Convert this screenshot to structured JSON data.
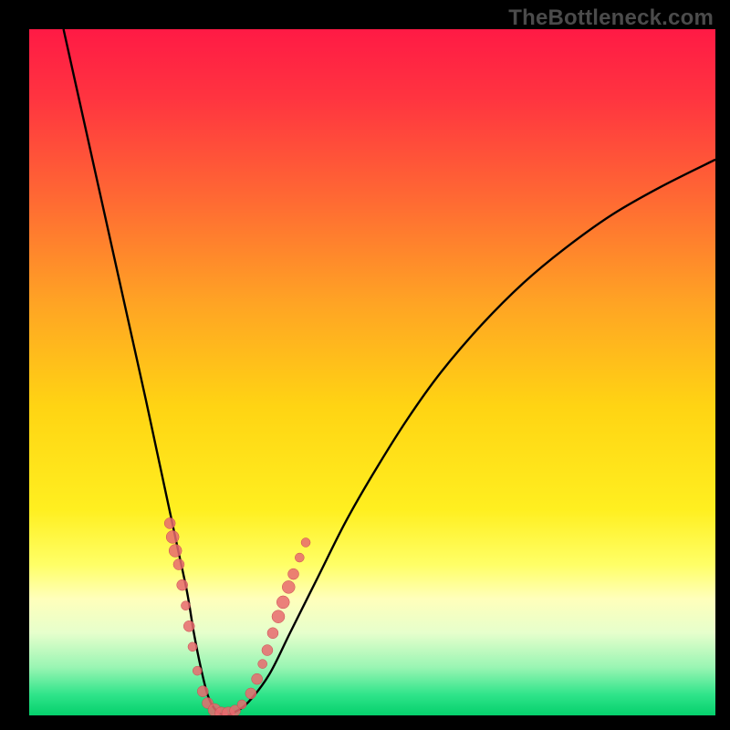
{
  "watermark": "TheBottleneck.com",
  "colors": {
    "frame": "#000000",
    "curve": "#000000",
    "markers_fill": "#e86a6f",
    "markers_stroke": "#c94b50",
    "gradient_stops": [
      {
        "offset": 0.0,
        "color": "#ff1a45"
      },
      {
        "offset": 0.1,
        "color": "#ff3440"
      },
      {
        "offset": 0.25,
        "color": "#ff6a33"
      },
      {
        "offset": 0.4,
        "color": "#ffa424"
      },
      {
        "offset": 0.55,
        "color": "#ffd413"
      },
      {
        "offset": 0.7,
        "color": "#ffef20"
      },
      {
        "offset": 0.78,
        "color": "#ffff66"
      },
      {
        "offset": 0.83,
        "color": "#ffffbb"
      },
      {
        "offset": 0.88,
        "color": "#e6ffcc"
      },
      {
        "offset": 0.93,
        "color": "#99f5b3"
      },
      {
        "offset": 0.97,
        "color": "#2fe48a"
      },
      {
        "offset": 1.0,
        "color": "#05d06c"
      }
    ]
  },
  "chart_data": {
    "type": "line",
    "title": "",
    "xlabel": "",
    "ylabel": "",
    "xlim": [
      0,
      100
    ],
    "ylim": [
      0,
      100
    ],
    "grid": false,
    "series": [
      {
        "name": "bottleneck-curve",
        "x": [
          5,
          7,
          9,
          11,
          13,
          15,
          17,
          18.5,
          20,
          21.5,
          23,
          24,
          25,
          26,
          27,
          28.5,
          30,
          32,
          35,
          38,
          42,
          46,
          50,
          55,
          60,
          66,
          72,
          78,
          85,
          92,
          100
        ],
        "values": [
          100,
          91,
          82,
          73,
          64,
          55,
          46,
          39,
          32,
          25,
          18,
          12,
          7,
          3,
          1,
          0,
          0.5,
          2,
          6,
          12,
          20,
          28,
          35,
          43,
          50,
          57,
          63,
          68,
          73,
          77,
          81
        ]
      }
    ],
    "markers": [
      {
        "x": 20.5,
        "y": 28,
        "r": 6
      },
      {
        "x": 20.9,
        "y": 26,
        "r": 7
      },
      {
        "x": 21.3,
        "y": 24,
        "r": 7
      },
      {
        "x": 21.8,
        "y": 22,
        "r": 6
      },
      {
        "x": 22.3,
        "y": 19,
        "r": 6
      },
      {
        "x": 22.8,
        "y": 16,
        "r": 5
      },
      {
        "x": 23.3,
        "y": 13,
        "r": 6
      },
      {
        "x": 23.8,
        "y": 10,
        "r": 5
      },
      {
        "x": 24.5,
        "y": 6.5,
        "r": 5
      },
      {
        "x": 25.3,
        "y": 3.5,
        "r": 6
      },
      {
        "x": 26.0,
        "y": 1.8,
        "r": 6
      },
      {
        "x": 27.0,
        "y": 0.8,
        "r": 7
      },
      {
        "x": 28.0,
        "y": 0.3,
        "r": 7
      },
      {
        "x": 29.0,
        "y": 0.3,
        "r": 7
      },
      {
        "x": 30.0,
        "y": 0.7,
        "r": 6
      },
      {
        "x": 31.0,
        "y": 1.6,
        "r": 5
      },
      {
        "x": 32.3,
        "y": 3.2,
        "r": 6
      },
      {
        "x": 33.2,
        "y": 5.3,
        "r": 6
      },
      {
        "x": 34.0,
        "y": 7.5,
        "r": 5
      },
      {
        "x": 34.7,
        "y": 9.5,
        "r": 6
      },
      {
        "x": 35.5,
        "y": 12,
        "r": 6
      },
      {
        "x": 36.3,
        "y": 14.4,
        "r": 7
      },
      {
        "x": 37.0,
        "y": 16.5,
        "r": 7
      },
      {
        "x": 37.8,
        "y": 18.7,
        "r": 7
      },
      {
        "x": 38.5,
        "y": 20.6,
        "r": 6
      },
      {
        "x": 39.4,
        "y": 23,
        "r": 5
      },
      {
        "x": 40.3,
        "y": 25.2,
        "r": 5
      }
    ],
    "annotations": []
  }
}
